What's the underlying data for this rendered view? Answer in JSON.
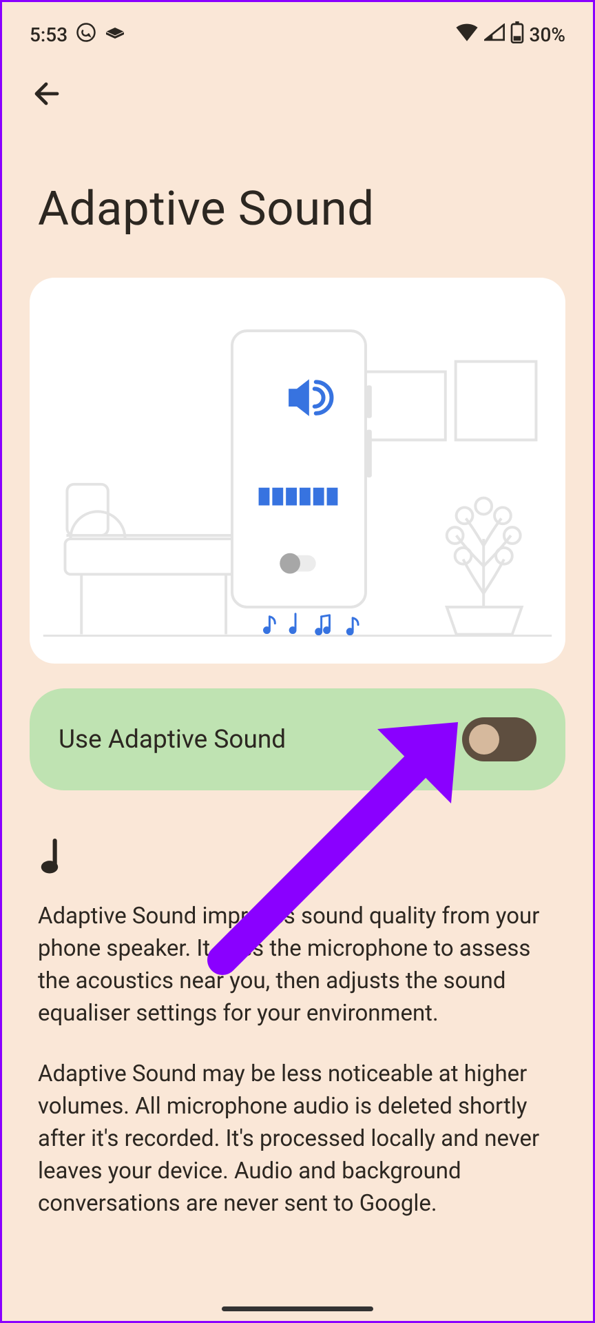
{
  "status": {
    "time": "5:53",
    "battery": "30%"
  },
  "title": "Adaptive Sound",
  "toggle": {
    "label": "Use Adaptive Sound",
    "state": false
  },
  "description": {
    "p1": "Adaptive Sound improves sound quality from your phone speaker. It uses the microphone to assess the acoustics near you, then adjusts the sound equaliser settings for your environment.",
    "p2": "Adaptive Sound may be less noticeable at higher volumes. All microphone audio is deleted shortly after it's recorded. It's processed locally and never leaves your device. Audio and background conversations are never sent to Google."
  }
}
